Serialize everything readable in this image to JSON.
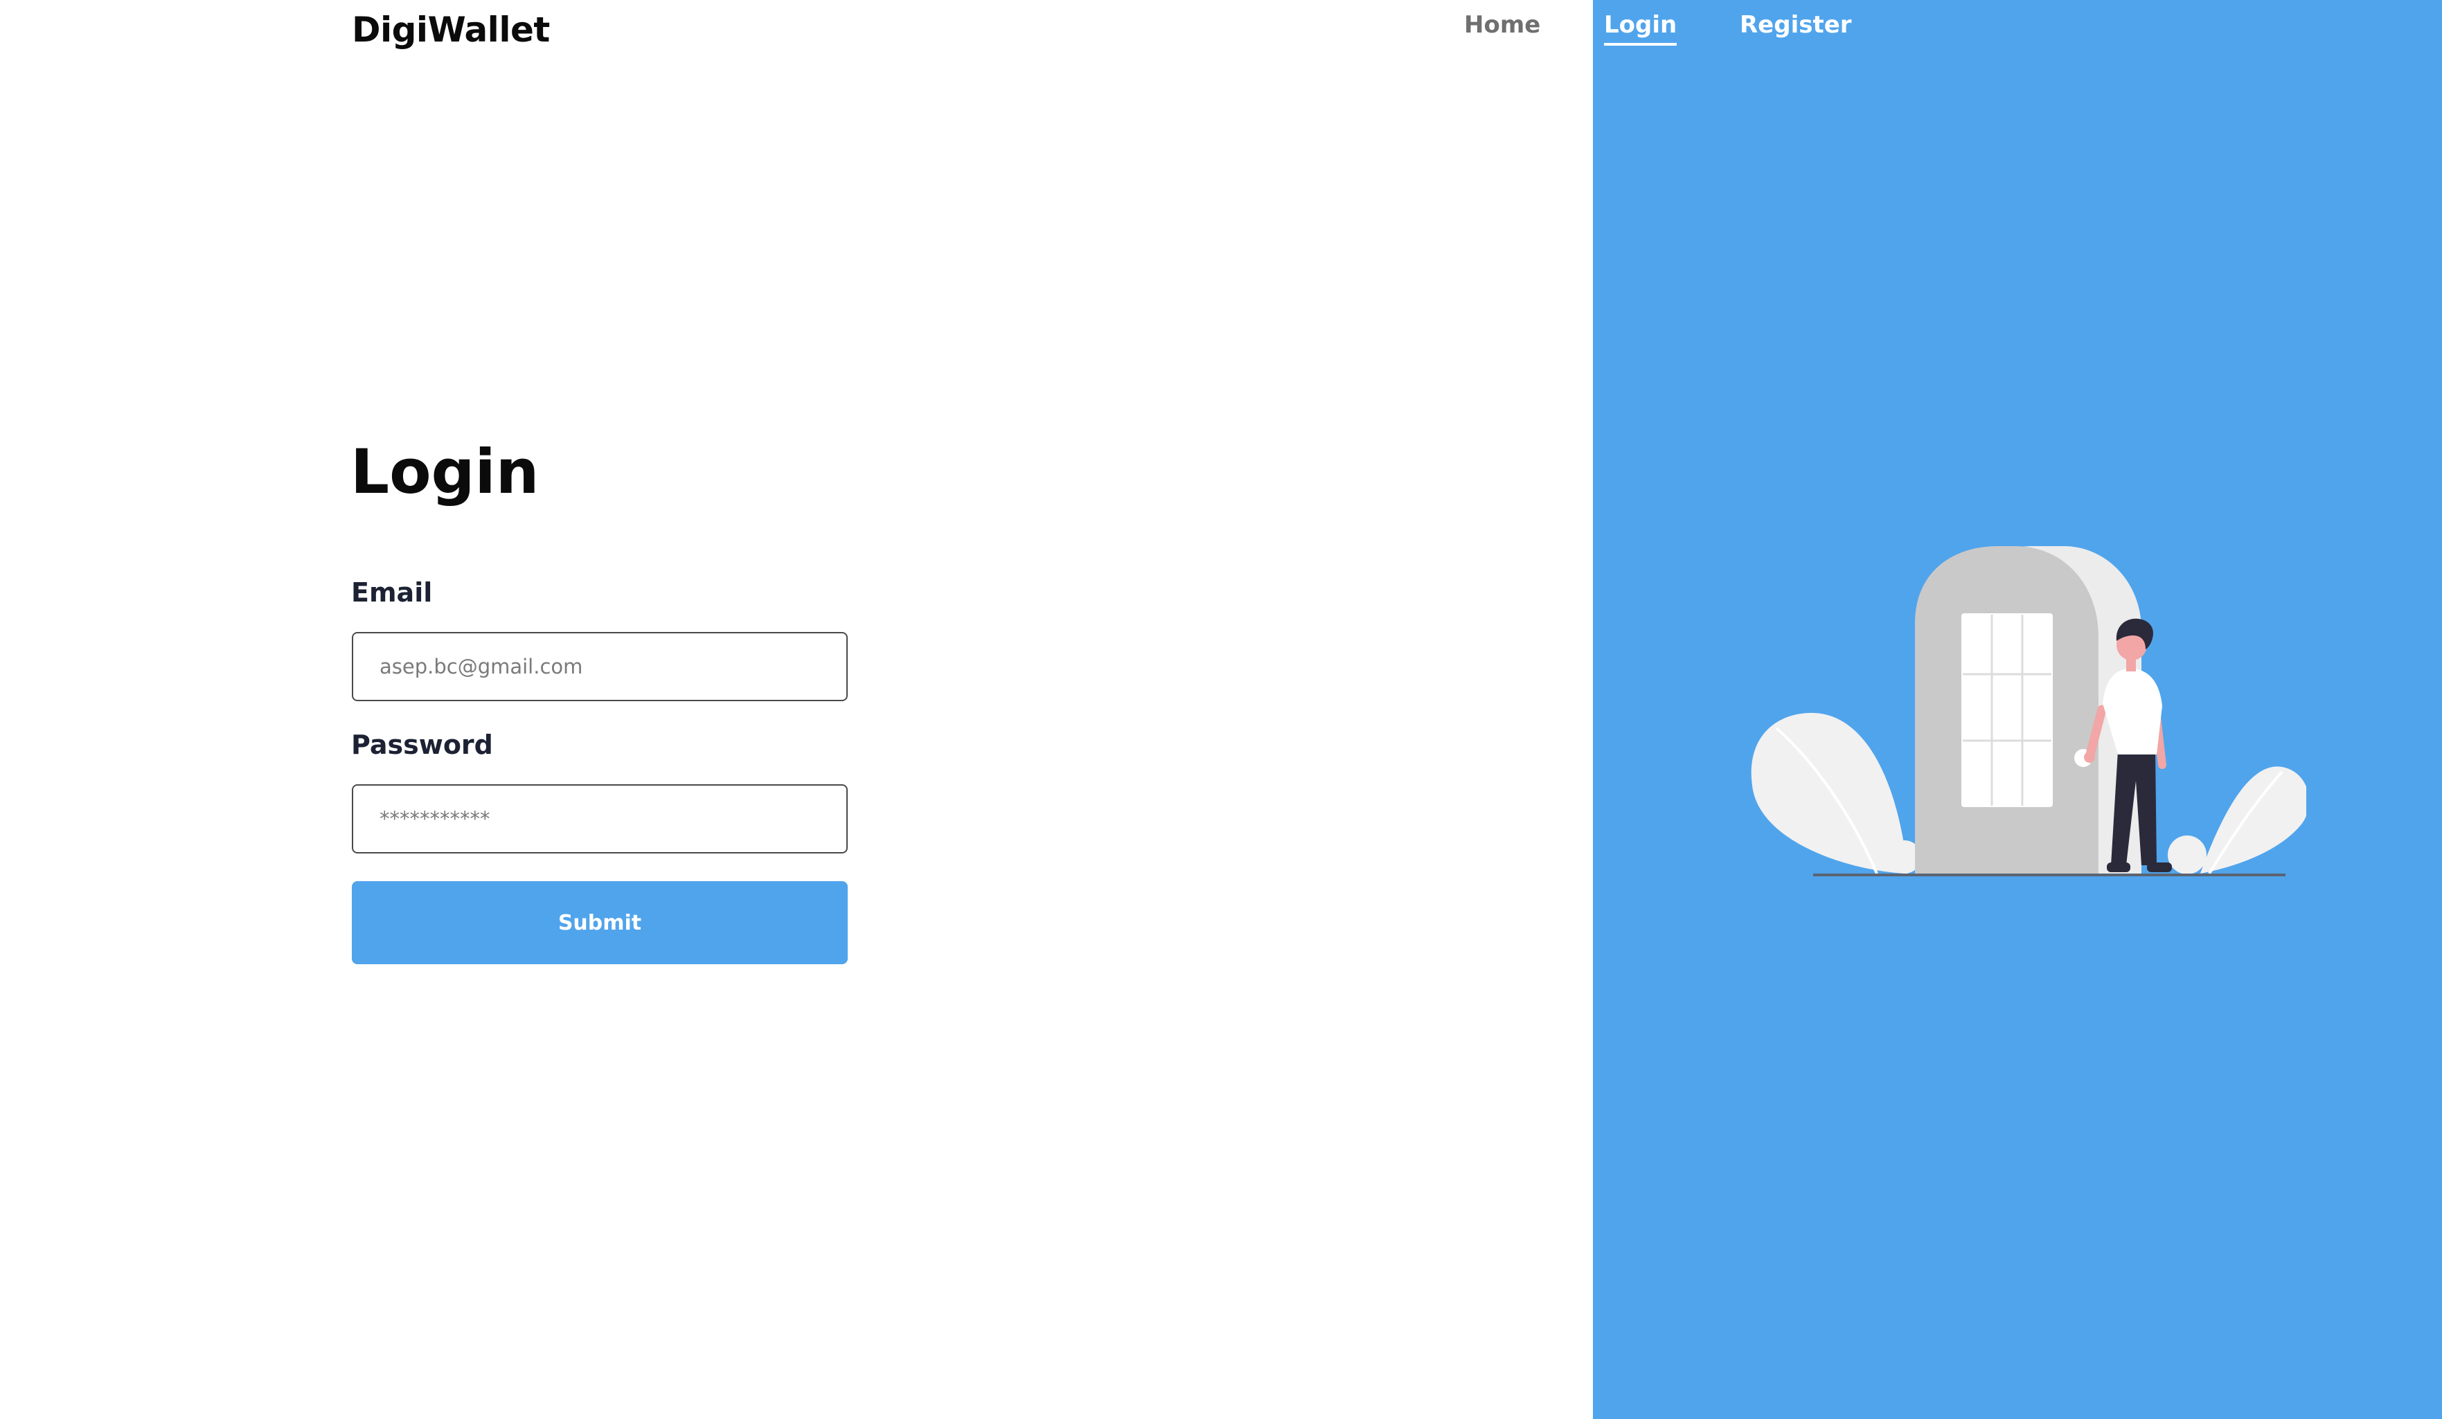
{
  "header": {
    "brand": "DigiWallet",
    "nav": {
      "home": "Home",
      "login": "Login",
      "register": "Register"
    }
  },
  "form": {
    "title": "Login",
    "email": {
      "label": "Email",
      "placeholder": "asep.bc@gmail.com"
    },
    "password": {
      "label": "Password",
      "placeholder": "***********"
    },
    "submit_label": "Submit"
  },
  "colors": {
    "accent": "#50a4ec",
    "text": "#0b0b0b",
    "label": "#1c2233",
    "nav_inactive": "#6f6f6f"
  },
  "illustration": {
    "icon": "person-at-door-illustration"
  }
}
